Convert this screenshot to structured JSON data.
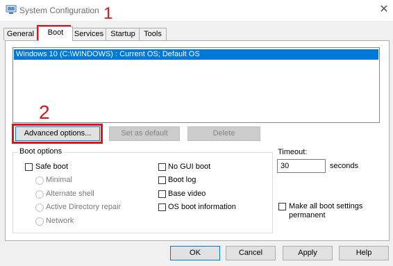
{
  "window": {
    "title": "System Configuration"
  },
  "tabs": [
    "General",
    "Boot",
    "Services",
    "Startup",
    "Tools"
  ],
  "os_list": {
    "items": [
      "Windows 10 (C:\\WINDOWS) : Current OS; Default OS"
    ]
  },
  "buttons": {
    "advanced": "Advanced options...",
    "set_default": "Set as default",
    "delete": "Delete"
  },
  "boot_options": {
    "title": "Boot options",
    "safe_boot": {
      "label": "Safe boot",
      "checked": false
    },
    "radios": [
      "Minimal",
      "Alternate shell",
      "Active Directory repair",
      "Network"
    ],
    "right_checks": [
      "No GUI boot",
      "Boot log",
      "Base video",
      "OS boot information"
    ]
  },
  "timeout": {
    "label": "Timeout:",
    "value": "30",
    "unit": "seconds"
  },
  "make_permanent": "Make all boot settings permanent",
  "footer": {
    "ok": "OK",
    "cancel": "Cancel",
    "apply": "Apply",
    "help": "Help"
  },
  "annotations": {
    "one": "1",
    "two": "2",
    "highlight_color": "#e0121b"
  }
}
